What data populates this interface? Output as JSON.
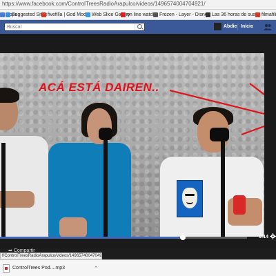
{
  "browser": {
    "url": "https://www.facebook.com/ControlTreesRadioArapulco/videos/1496574004704921/"
  },
  "bookmarks": [
    {
      "label": "Apps",
      "color": "#4b79d8"
    },
    {
      "label": "Suggested Sites",
      "color": "#3b8ee0"
    },
    {
      "label": "fivefilla | God Mode",
      "color": "#d23a2b"
    },
    {
      "label": "Web Slice Gallery",
      "color": "#3a9be0"
    },
    {
      "label": "on line watch",
      "color": "#e02020"
    },
    {
      "label": "Frozen - Layer - Disney",
      "color": "#555555"
    },
    {
      "label": "Las 36 horas de sus",
      "color": "#333333"
    },
    {
      "label": "filmafilia",
      "color": "#d23a2b"
    }
  ],
  "fb_header": {
    "search_placeholder": "Buscar",
    "user_name": "Abdiel",
    "home_label": "Inicio"
  },
  "video": {
    "caption": "ACÁ ESTÁ DAIREN..",
    "time": "6:14",
    "progress_fraction": 0.74
  },
  "below_video": {
    "share_label": "Compartir"
  },
  "status_url": "f/ControlTreesRadioArapulco/videos/1496574004704921/",
  "download": {
    "filename": "ControlTrees Pod....mp3"
  }
}
